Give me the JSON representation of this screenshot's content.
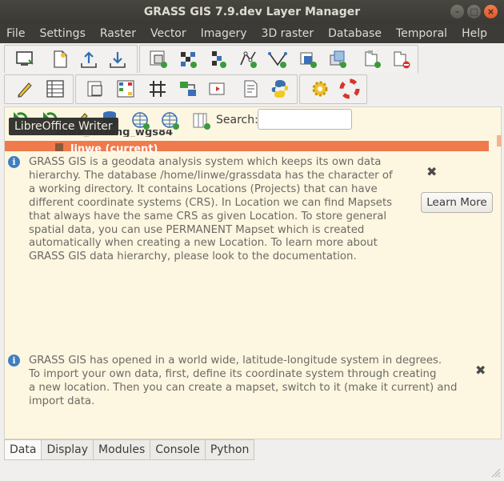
{
  "window": {
    "title": "GRASS GIS 7.9.dev Layer Manager",
    "buttons": [
      "–",
      "□",
      "×"
    ]
  },
  "menubar": [
    "File",
    "Settings",
    "Raster",
    "Vector",
    "Imagery",
    "3D raster",
    "Database",
    "Temporal",
    "Help"
  ],
  "toolbar_row1": [
    "new-display-icon",
    "new-workspace-icon",
    "load-workspace-icon",
    "save-workspace-icon",
    "add-raster-icon",
    "add-raster-misc-icon",
    "add-raster-group-icon",
    "add-vector-icon",
    "add-vector-misc-icon",
    "add-group-icon",
    "add-overlay-icon",
    "add-layer-icon",
    "remove-layer-icon"
  ],
  "toolbar_row2": [
    "edit-icon",
    "attribute-table-icon",
    "map-calculator-icon",
    "graphical-modeler-icon",
    "grid-icon",
    "georectifier-icon",
    "animation-icon",
    "script-icon",
    "python-icon",
    "settings-icon",
    "help-icon"
  ],
  "data_toolbar": [
    "refresh-icon",
    "switch-mapset-icon",
    "rename-icon",
    "new-database-icon",
    "new-location-icon",
    "new-location-add-icon",
    "add-mapset-icon"
  ],
  "search": {
    "label": "Search:",
    "placeholder": ""
  },
  "tooltip": "LibreOffice Writer",
  "tree": {
    "partial_item": "lnwe_latlong_wgs84",
    "current_mapset": "linwe  (current)"
  },
  "messages": [
    {
      "lines": [
        "GRASS GIS is a geodata analysis system which keeps its own data",
        "hierarchy. The database /home/linwe/grassdata has the character of",
        "a working directory. It contains Locations (Projects) that can have",
        "different coordinate systems (CRS). In Location we can find Mapsets",
        "that always have the same CRS as given Location. To store general",
        "spatial data, you can use PERMANENT Mapset which is created",
        "automatically when creating a new Location. To learn more about",
        "GRASS GIS data hierarchy, please look to the documentation."
      ],
      "button": "Learn More",
      "close": "✖"
    },
    {
      "lines": [
        "GRASS GIS has opened in a world wide, latitude-longitude system in degrees.",
        "To import your own data, first, define its coordinate system through creating",
        "a new location. Then you can create a mapset, switch to it (make it current) and",
        "import data."
      ],
      "close": "✖"
    }
  ],
  "tabs": [
    "Data",
    "Display",
    "Modules",
    "Console",
    "Python"
  ],
  "colors": {
    "accent": "#ef7a4c",
    "panel_bg": "#fdf6e1",
    "info_blue": "#3f7fc1",
    "titlebar": "#3c3b37"
  }
}
